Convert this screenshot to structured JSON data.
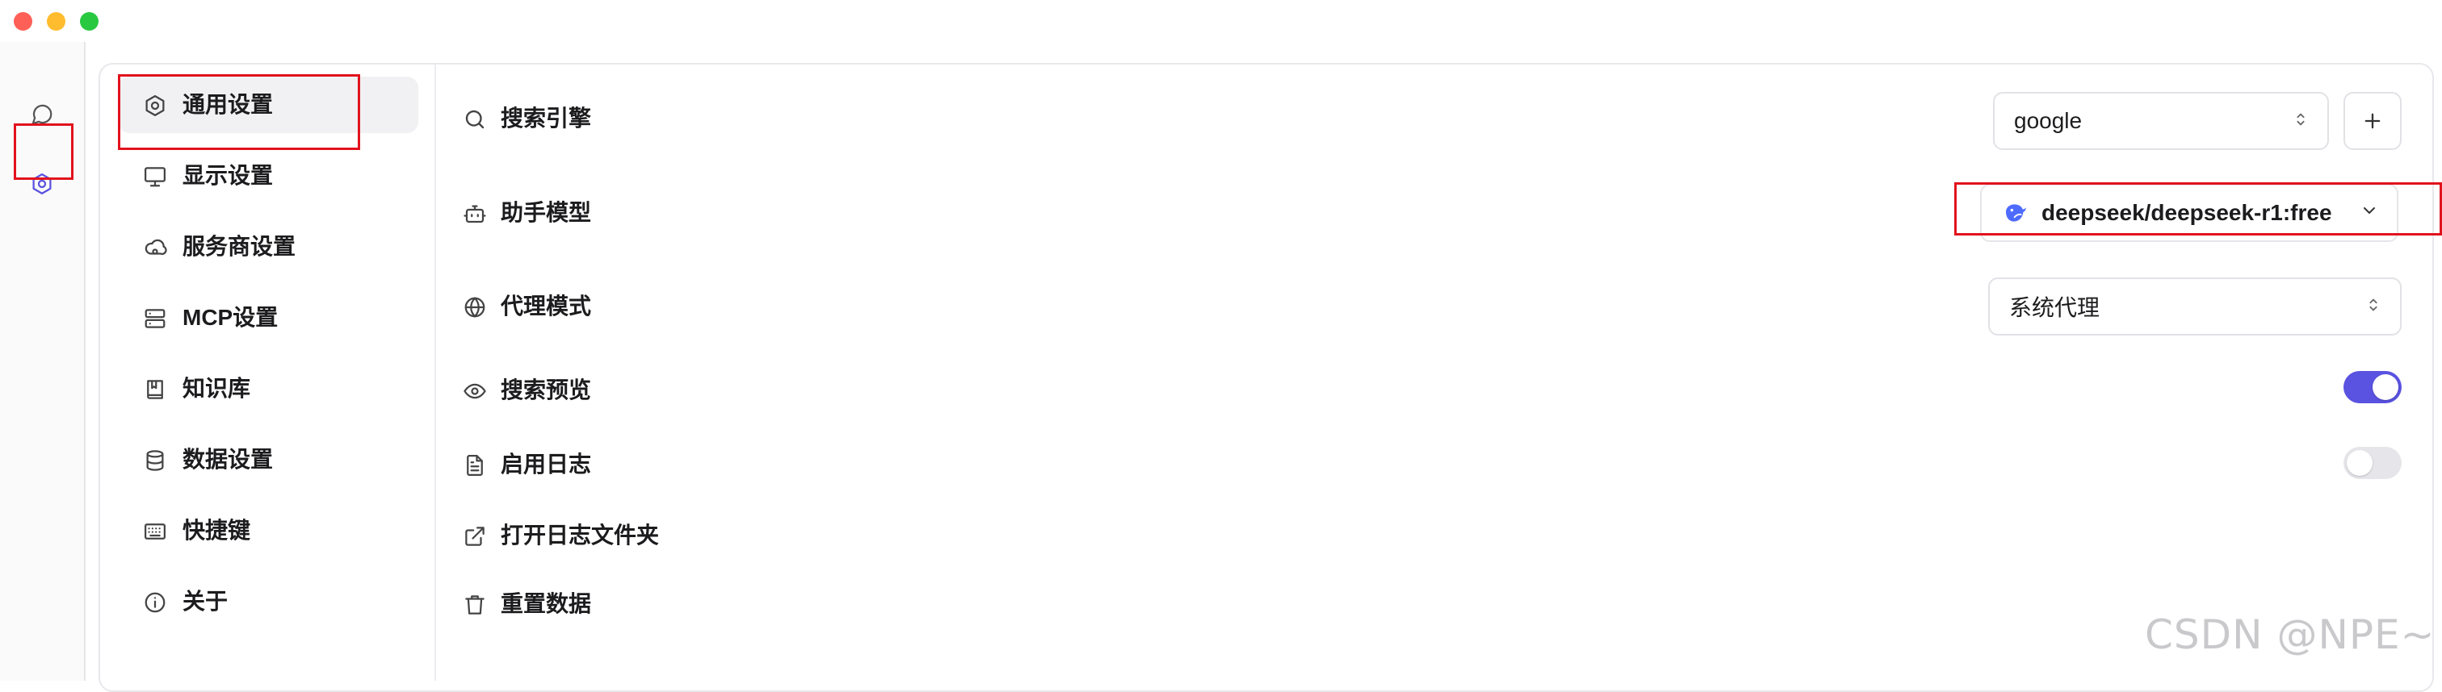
{
  "colors": {
    "accent": "#5a52e0",
    "highlight_box": "#e1131d",
    "traffic_red": "#fe5f57",
    "traffic_yellow": "#febc2e",
    "traffic_green": "#28c840"
  },
  "rail": {
    "items": [
      {
        "icon": "chat-bubble-icon"
      },
      {
        "icon": "settings-hexagon-icon",
        "active": true
      }
    ]
  },
  "nav": {
    "items": [
      {
        "label": "通用设置",
        "icon": "settings-hexagon-icon",
        "active": true
      },
      {
        "label": "显示设置",
        "icon": "monitor-icon"
      },
      {
        "label": "服务商设置",
        "icon": "cloud-icon"
      },
      {
        "label": "MCP设置",
        "icon": "server-icon"
      },
      {
        "label": "知识库",
        "icon": "book-icon"
      },
      {
        "label": "数据设置",
        "icon": "database-icon"
      },
      {
        "label": "快捷键",
        "icon": "keyboard-icon"
      },
      {
        "label": "关于",
        "icon": "info-icon"
      }
    ]
  },
  "settings": {
    "search_engine": {
      "label": "搜索引擎",
      "icon": "search-icon",
      "value": "google"
    },
    "assistant_model": {
      "label": "助手模型",
      "icon": "bot-icon",
      "value": "deepseek/deepseek-r1:free",
      "model_icon": "deepseek-whale-icon"
    },
    "proxy_mode": {
      "label": "代理模式",
      "icon": "globe-icon",
      "value": "系统代理"
    },
    "search_preview": {
      "label": "搜索预览",
      "icon": "eye-icon",
      "enabled": true
    },
    "enable_logging": {
      "label": "启用日志",
      "icon": "file-text-icon",
      "enabled": false
    },
    "open_log_folder": {
      "label": "打开日志文件夹",
      "icon": "external-link-icon"
    },
    "reset_data": {
      "label": "重置数据",
      "icon": "trash-icon"
    }
  },
  "watermark": "CSDN @NPE~"
}
